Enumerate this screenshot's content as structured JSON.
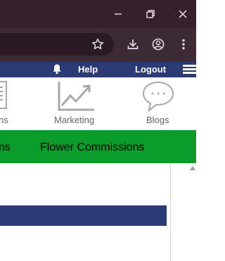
{
  "browser": {
    "window_controls": {
      "minimize": "minimize-icon",
      "restore": "restore-icon",
      "close": "close-icon"
    },
    "toolbar_icons": [
      "bookmark-star-icon",
      "download-icon",
      "profile-icon",
      "more-vert-icon"
    ]
  },
  "topnav": {
    "help": "Help",
    "logout": "Logout",
    "icons": [
      "bell-icon",
      "hamburger-menu-icon"
    ]
  },
  "tiles": [
    {
      "label": "ns",
      "icon": "document-icon"
    },
    {
      "label": "Marketing",
      "icon": "chart-trend-icon"
    },
    {
      "label": "Blogs",
      "icon": "speech-bubble-icon"
    }
  ],
  "greennav": {
    "items": [
      "ns",
      "Flower Commissions"
    ]
  },
  "colors": {
    "titlebar": "#35202c",
    "toolbar": "#3c2a35",
    "site_nav": "#2c3a74",
    "green_nav": "#0b9b2a"
  }
}
